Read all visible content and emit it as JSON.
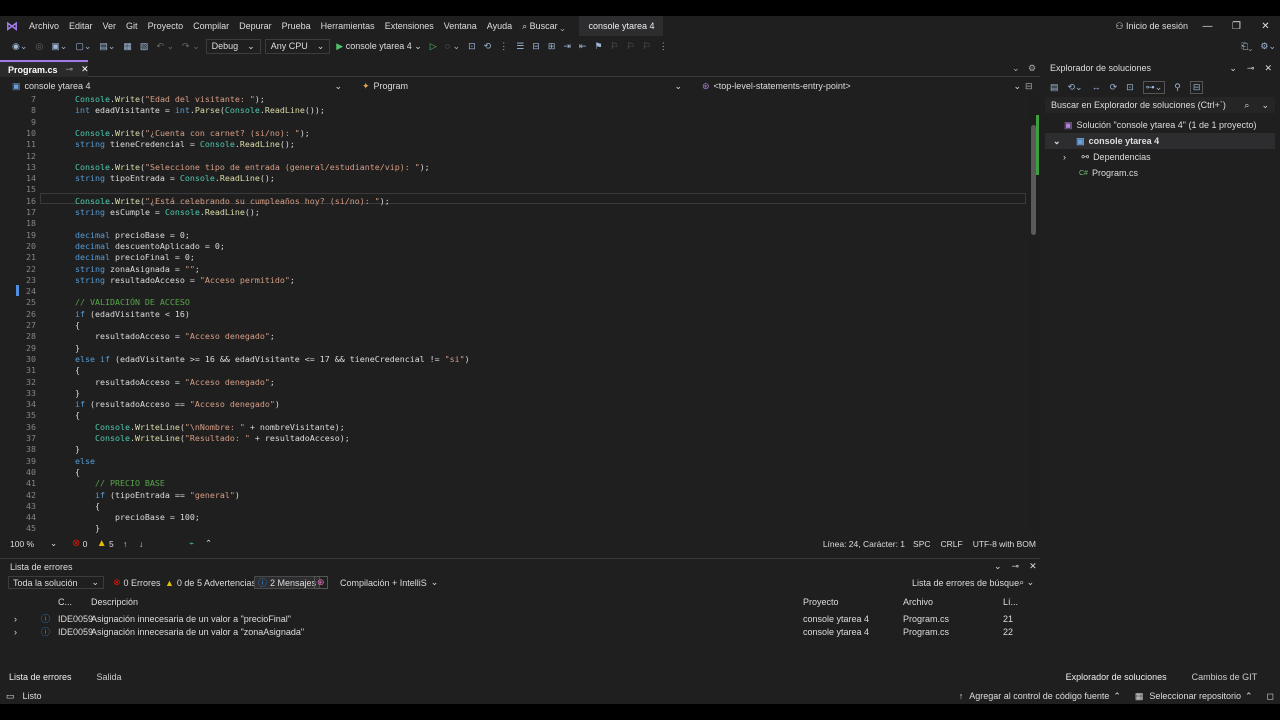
{
  "menu": {
    "items": [
      "Archivo",
      "Editar",
      "Ver",
      "Git",
      "Proyecto",
      "Compilar",
      "Depurar",
      "Prueba",
      "Herramientas",
      "Extensiones",
      "Ventana",
      "Ayuda"
    ],
    "search": "Buscar",
    "solution": "console ytarea 4",
    "signin": "Inicio de sesión"
  },
  "toolbar": {
    "config": "Debug",
    "platform": "Any CPU",
    "run": "console ytarea 4"
  },
  "editor": {
    "tab": "Program.cs",
    "project": "console ytarea 4",
    "class": "Program",
    "member": "<top-level-statements-entry-point>"
  },
  "status_editor": {
    "zoom": "100 %",
    "errors": "0",
    "warnings": "5",
    "position": "Línea: 24, Carácter: 1",
    "spc": "SPC",
    "crlf": "CRLF",
    "encoding": "UTF-8 with BOM"
  },
  "explorer": {
    "title": "Explorador de soluciones",
    "search": "Buscar en Explorador de soluciones (Ctrl+`)",
    "solution": "Solución \"console ytarea 4\" (1 de 1 proyecto)",
    "project": "console ytarea 4",
    "deps": "Dependencias",
    "file": "Program.cs"
  },
  "errors": {
    "title": "Lista de errores",
    "scope": "Toda la solución",
    "errcount": "0 Errores",
    "warncount": "0 de 5 Advertencias",
    "msgcount": "2 Mensajes",
    "build": "Compilación + IntelliS",
    "search": "Lista de errores de búsque",
    "cols": [
      "C...",
      "Descripción",
      "Proyecto",
      "Archivo",
      "Lí..."
    ],
    "rows": [
      {
        "code": "IDE0059",
        "desc": "Asignación innecesaria de un valor a \"precioFinal\"",
        "project": "console ytarea 4",
        "file": "Program.cs",
        "line": "21"
      },
      {
        "code": "IDE0059",
        "desc": "Asignación innecesaria de un valor a \"zonaAsignada\"",
        "project": "console ytarea 4",
        "file": "Program.cs",
        "line": "22"
      }
    ]
  },
  "bottom_tabs": {
    "errors": "Lista de errores",
    "output": "Salida",
    "explorer": "Explorador de soluciones",
    "git": "Cambios de GIT"
  },
  "statusbar": {
    "ready": "Listo",
    "addsource": "Agregar al control de código fuente",
    "repo": "Seleccionar repositorio"
  },
  "code_lines": [
    {
      "n": "7",
      "t": "Console.Write(\"Edad del visitante: \");"
    },
    {
      "n": "8",
      "t": "int edadVisitante = int.Parse(Console.ReadLine());"
    },
    {
      "n": "9",
      "t": ""
    },
    {
      "n": "10",
      "t": "Console.Write(\"¿Cuenta con carnet? (si/no): \");"
    },
    {
      "n": "11",
      "t": "string tieneCredencial = Console.ReadLine();"
    },
    {
      "n": "12",
      "t": ""
    },
    {
      "n": "13",
      "t": "Console.Write(\"Seleccione tipo de entrada (general/estudiante/vip): \");"
    },
    {
      "n": "14",
      "t": "string tipoEntrada = Console.ReadLine();"
    },
    {
      "n": "15",
      "t": ""
    },
    {
      "n": "16",
      "t": "Console.Write(\"¿Está celebrando su cumpleaños hoy? (si/no): \");"
    },
    {
      "n": "17",
      "t": "string esCumple = Console.ReadLine();"
    },
    {
      "n": "18",
      "t": ""
    },
    {
      "n": "19",
      "t": "decimal precioBase = 0;"
    },
    {
      "n": "20",
      "t": "decimal descuentoAplicado = 0;"
    },
    {
      "n": "21",
      "t": "decimal precioFinal = 0;"
    },
    {
      "n": "22",
      "t": "string zonaAsignada = \"\";"
    },
    {
      "n": "23",
      "t": "string resultadoAcceso = \"Acceso permitido\";"
    },
    {
      "n": "24",
      "t": ""
    },
    {
      "n": "25",
      "t": "// VALIDACIÓN DE ACCESO"
    },
    {
      "n": "26",
      "t": "if (edadVisitante < 16)"
    },
    {
      "n": "27",
      "t": "{"
    },
    {
      "n": "28",
      "t": "    resultadoAcceso = \"Acceso denegado\";"
    },
    {
      "n": "29",
      "t": "}"
    },
    {
      "n": "30",
      "t": "else if (edadVisitante >= 16 && edadVisitante <= 17 && tieneCredencial != \"si\")"
    },
    {
      "n": "31",
      "t": "{"
    },
    {
      "n": "32",
      "t": "    resultadoAcceso = \"Acceso denegado\";"
    },
    {
      "n": "33",
      "t": "}"
    },
    {
      "n": "34",
      "t": "if (resultadoAcceso == \"Acceso denegado\")"
    },
    {
      "n": "35",
      "t": "{"
    },
    {
      "n": "36",
      "t": "    Console.WriteLine(\"\\nNombre: \" + nombreVisitante);"
    },
    {
      "n": "37",
      "t": "    Console.WriteLine(\"Resultado: \" + resultadoAcceso);"
    },
    {
      "n": "38",
      "t": "}"
    },
    {
      "n": "39",
      "t": "else"
    },
    {
      "n": "40",
      "t": "{"
    },
    {
      "n": "41",
      "t": "    // PRECIO BASE"
    },
    {
      "n": "42",
      "t": "    if (tipoEntrada == \"general\")"
    },
    {
      "n": "43",
      "t": "    {"
    },
    {
      "n": "44",
      "t": "        precioBase = 100;"
    },
    {
      "n": "45",
      "t": "    }"
    }
  ]
}
